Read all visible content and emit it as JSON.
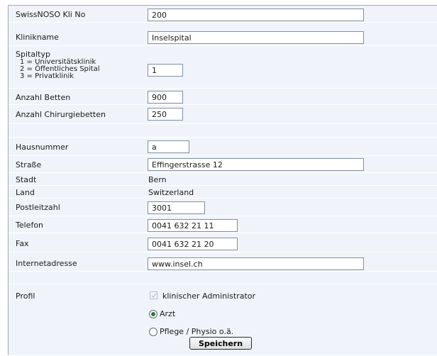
{
  "fields": {
    "kli_no": {
      "label": "SwissNOSO Kli No",
      "value": "200"
    },
    "klinikname": {
      "label": "Klinikname",
      "value": "Inselspital"
    },
    "spitaltyp": {
      "label": "Spitaltyp",
      "options": [
        "1 = Universitätsklinik",
        "2 = Öffentliches Spital",
        "3 = Privatklinik"
      ],
      "value": "1"
    },
    "betten": {
      "label": "Anzahl Betten",
      "value": "900"
    },
    "chirurgiebetten": {
      "label": "Anzahl Chirurgiebetten",
      "value": "250"
    },
    "hausnummer": {
      "label": "Hausnummer",
      "value": "a"
    },
    "strasse": {
      "label": "Straße",
      "value": "Effingerstrasse 12"
    },
    "stadt": {
      "label": "Stadt",
      "value": "Bern"
    },
    "land": {
      "label": "Land",
      "value": "Switzerland"
    },
    "plz": {
      "label": "Postleitzahl",
      "value": "3001"
    },
    "telefon": {
      "label": "Telefon",
      "value": "0041 632 21 11"
    },
    "fax": {
      "label": "Fax",
      "value": "0041 632 21 20"
    },
    "web": {
      "label": "Internetadresse",
      "value": "www.insel.ch"
    }
  },
  "profil": {
    "label": "Profil",
    "admin_label": "klinischer Administrator",
    "admin_checked": true,
    "admin_disabled": true,
    "roles": [
      {
        "label": "Arzt",
        "selected": true
      },
      {
        "label": "Pflege / Physio o.ä.",
        "selected": false
      }
    ]
  },
  "save_label": "Speichern"
}
